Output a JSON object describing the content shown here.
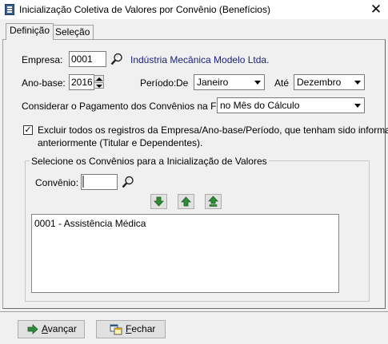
{
  "window": {
    "title": "Inicialização Coletiva de Valores por Convênio (Benefícios)",
    "close_label": "✕"
  },
  "tabs": [
    {
      "label": "Definição",
      "active": true
    },
    {
      "label": "Seleção",
      "active": false
    }
  ],
  "form": {
    "empresa_label": "Empresa:",
    "empresa_value": "0001",
    "company_name": "Indústria Mecânica Modelo Ltda.",
    "ano_base_label": "Ano-base:",
    "ano_base_value": "2016",
    "periodo_label": "Período:",
    "de_label": "De",
    "periodo_de_value": "Janeiro",
    "ate_label": "Até",
    "periodo_ate_value": "Dezembro",
    "considerar_label": "Considerar o Pagamento dos Convênios na Folha:",
    "considerar_value": "no Mês do Cálculo",
    "excluir_checked": true,
    "excluir_line1": "Excluir todos os registros da Empresa/Ano-base/Período, que tenham sido informados",
    "excluir_line2": "anteriormente (Titular e Dependentes)."
  },
  "convenios_group": {
    "title": "Selecione os Convênios para a Inicialização de Valores",
    "convenio_label": "Convênio:",
    "convenio_value": "",
    "items": [
      "0001 - Assistência Médica"
    ]
  },
  "buttons": {
    "avancar_prefix": "",
    "avancar_underlined": "A",
    "avancar_rest": "vançar",
    "fechar_underlined": "F",
    "fechar_rest": "echar"
  },
  "colors": {
    "company_link": "#1a237e",
    "arrow_green": "#2e8b3a",
    "window_bg": "#f0f0f0"
  }
}
